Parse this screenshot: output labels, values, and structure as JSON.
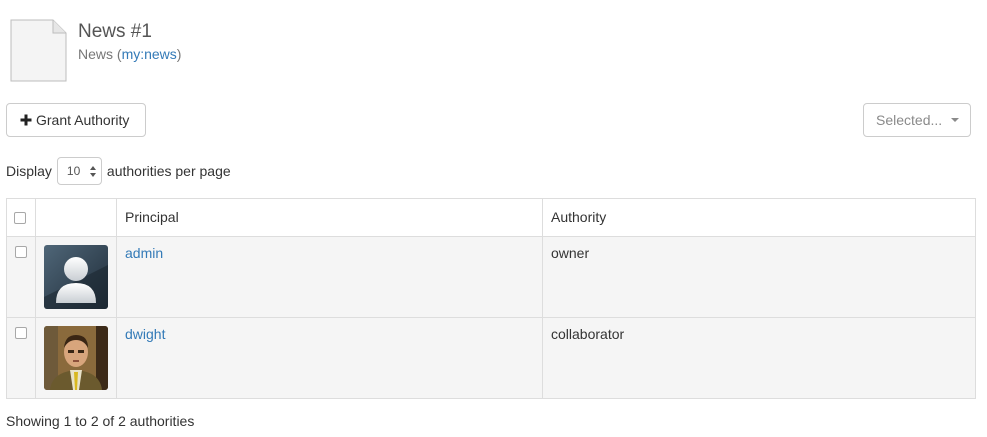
{
  "header": {
    "title": "News #1",
    "subtitle_prefix": "News (",
    "subtitle_link": "my:news",
    "subtitle_suffix": ")",
    "icon": "document-icon"
  },
  "toolbar": {
    "grant_label": "Grant Authority",
    "grant_icon": "plus-icon",
    "selected_label": "Selected...",
    "selected_icon": "caret-down-icon"
  },
  "pagination": {
    "display_label": "Display",
    "page_size": "10",
    "per_page_label": "authorities per page"
  },
  "table": {
    "columns": [
      "",
      "",
      "Principal",
      "Authority"
    ],
    "rows": [
      {
        "principal": "admin",
        "authority": "owner",
        "avatar": "default-user-avatar"
      },
      {
        "principal": "dwight",
        "authority": "collaborator",
        "avatar": "user-photo-avatar"
      }
    ]
  },
  "footer": {
    "info": "Showing 1 to 2 of 2 authorities"
  },
  "colors": {
    "link": "#337ab7",
    "row_background": "#f5f5f5",
    "border": "#dddddd"
  }
}
